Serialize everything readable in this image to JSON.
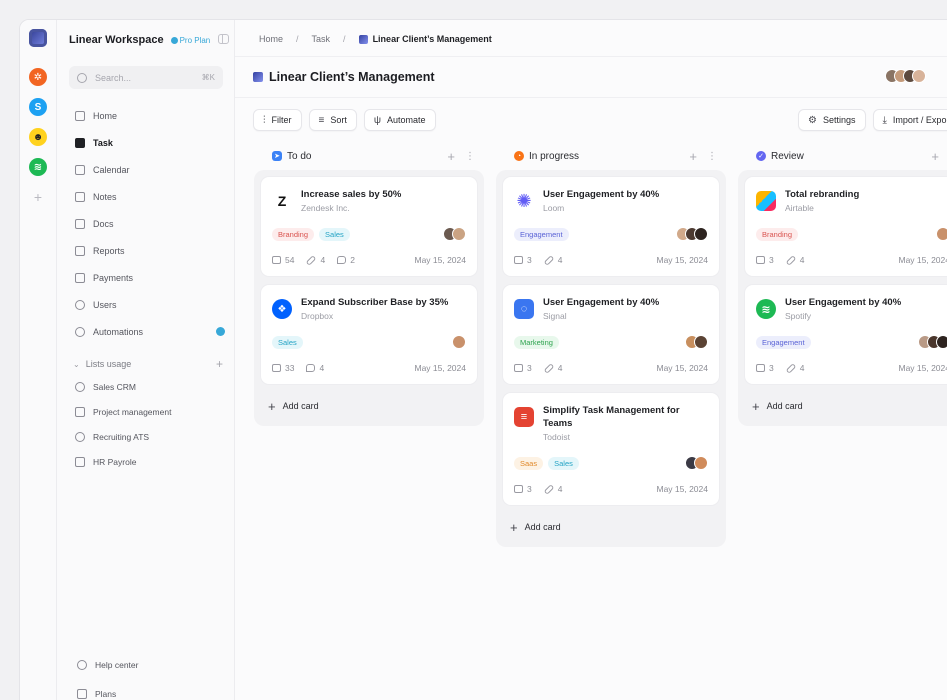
{
  "workspace": {
    "title": "Linear Workspace",
    "plan": "Pro Plan"
  },
  "search": {
    "placeholder": "Search...",
    "shortcut": "⌘K"
  },
  "nav": [
    {
      "label": "Home",
      "icon": "home-icon"
    },
    {
      "label": "Task",
      "icon": "task-icon",
      "active": true
    },
    {
      "label": "Calendar",
      "icon": "calendar-icon"
    },
    {
      "label": "Notes",
      "icon": "notes-icon"
    },
    {
      "label": "Docs",
      "icon": "docs-icon"
    },
    {
      "label": "Reports",
      "icon": "reports-icon"
    },
    {
      "label": "Payments",
      "icon": "payments-icon"
    },
    {
      "label": "Users",
      "icon": "users-icon"
    },
    {
      "label": "Automations",
      "icon": "automations-icon"
    }
  ],
  "lists": {
    "heading": "Lists usage",
    "items": [
      "Sales CRM",
      "Project management",
      "Recruiting ATS",
      "HR Payrole"
    ]
  },
  "footer": {
    "help": "Help center",
    "plans": "Plans"
  },
  "breadcrumb": {
    "home": "Home",
    "task": "Task",
    "current": "Linear Client’s Management"
  },
  "page": {
    "title": "Linear Client’s Management"
  },
  "toolbar": {
    "filter": "Filter",
    "sort": "Sort",
    "automate": "Automate",
    "settings": "Settings",
    "import": "Import / Expo"
  },
  "add_card": "Add card",
  "columns": [
    {
      "title": "To do",
      "cards": [
        {
          "title": "Increase sales by 50%",
          "company": "Zendesk Inc.",
          "tags": [
            "Branding",
            "Sales"
          ],
          "files": "54",
          "links": "4",
          "comments": "2",
          "date": "May 15, 2024"
        },
        {
          "title": "Expand Subscriber Base by 35%",
          "company": "Dropbox",
          "tags": [
            "Sales"
          ],
          "files": "33",
          "comments": "4",
          "date": "May 15, 2024"
        }
      ]
    },
    {
      "title": "In progress",
      "cards": [
        {
          "title": "User Engagement by 40%",
          "company": "Loom",
          "tags": [
            "Engagement"
          ],
          "files": "3",
          "links": "4",
          "date": "May 15, 2024"
        },
        {
          "title": "User Engagement by 40%",
          "company": "Signal",
          "tags": [
            "Marketing"
          ],
          "files": "3",
          "links": "4",
          "date": "May 15, 2024"
        },
        {
          "title": "Simplify Task Management for Teams",
          "company": "Todoist",
          "tags": [
            "Saas",
            "Sales"
          ],
          "files": "3",
          "links": "4",
          "date": "May 15, 2024"
        }
      ]
    },
    {
      "title": "Review",
      "cards": [
        {
          "title": "Total rebranding",
          "company": "Airtable",
          "tags": [
            "Branding"
          ],
          "files": "3",
          "links": "4",
          "date": "May 15, 2024"
        },
        {
          "title": "User Engagement by 40%",
          "company": "Spotify",
          "tags": [
            "Engagement"
          ],
          "files": "3",
          "links": "4",
          "date": "May 15, 2024"
        }
      ]
    }
  ],
  "colors": {
    "accent": "#37a8d8",
    "todo": "#3b82f6",
    "in_progress": "#f97316",
    "review": "#6366f1"
  }
}
